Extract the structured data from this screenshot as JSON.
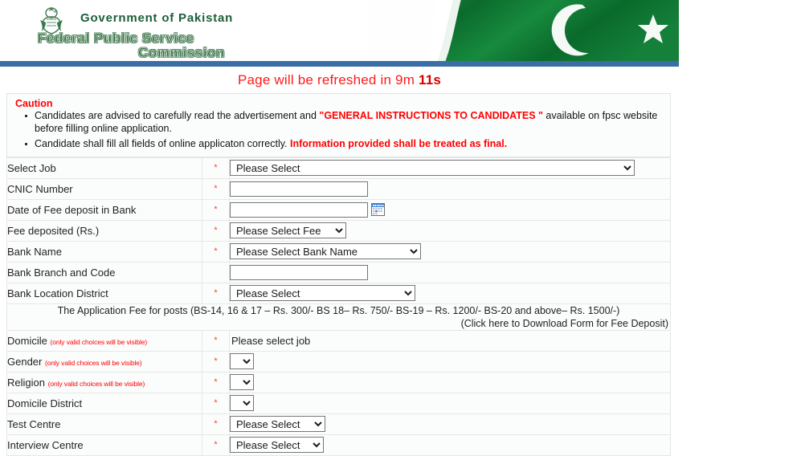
{
  "banner": {
    "emblem_alt": "state-emblem-of-pakistan",
    "gov_title": "Government of Pakistan",
    "org_line1": "Federal Public Service",
    "org_line2": "Commission",
    "flag_alt": "pakistan-flag"
  },
  "refresh": {
    "prefix": "Page will be refreshed in 9m ",
    "seconds": "11s"
  },
  "caution": {
    "title": "Caution",
    "items": [
      {
        "text_before": "Candidates are advised to carefully read the advertisement and ",
        "emphasis": "\"GENERAL INSTRUCTIONS TO CANDIDATES \"",
        "text_after": " available on fpsc website before filling online application."
      },
      {
        "text_before": "Candidate shall fill all fields of online applicaton correctly. ",
        "emphasis": "Information provided shall be treated as final.",
        "text_after": ""
      }
    ]
  },
  "form": {
    "required_mark": "*",
    "rows": {
      "select_job": {
        "label": "Select Job",
        "value": "Please Select"
      },
      "cnic": {
        "label": "CNIC Number",
        "value": "",
        "placeholder": ""
      },
      "fee_date": {
        "label": "Date of Fee deposit in Bank",
        "value": "",
        "placeholder": "",
        "icon": "calendar-icon"
      },
      "fee_amount": {
        "label": "Fee deposited (Rs.)",
        "value": "Please Select Fee"
      },
      "bank_name": {
        "label": "Bank Name",
        "value": "Please Select Bank Name"
      },
      "bank_branch": {
        "label": "Bank Branch and Code",
        "value": "",
        "placeholder": ""
      },
      "bank_district": {
        "label": "Bank Location District",
        "value": "Please Select"
      },
      "domicile": {
        "label": "Domicile",
        "hint": "(only valid choices will be visible)",
        "value": "Please select job"
      },
      "gender": {
        "label": "Gender",
        "hint": "(only valid choices will be visible)",
        "value": ""
      },
      "religion": {
        "label": "Religion",
        "hint": "(only valid choices will be visible)",
        "value": ""
      },
      "domicile_district": {
        "label": "Domicile District",
        "value": ""
      },
      "test_centre": {
        "label": "Test Centre",
        "value": "Please Select"
      },
      "interview_centre": {
        "label": "Interview Centre",
        "value": "Please Select"
      }
    },
    "fee_note": {
      "line1": "The Application Fee for posts (BS-14, 16 & 17 – Rs. 300/- BS 18– Rs. 750/- BS-19 – Rs. 1200/- BS-20 and above– Rs. 1500/-)",
      "line2": "(Click here to Download Form for Fee Deposit)"
    }
  },
  "colors": {
    "accent_blue": "#3b6ea5",
    "flag_green": "#01411c",
    "alert_red": "#ff0000",
    "required_red": "#ff3b30",
    "heading_green": "#2e6b3e"
  }
}
